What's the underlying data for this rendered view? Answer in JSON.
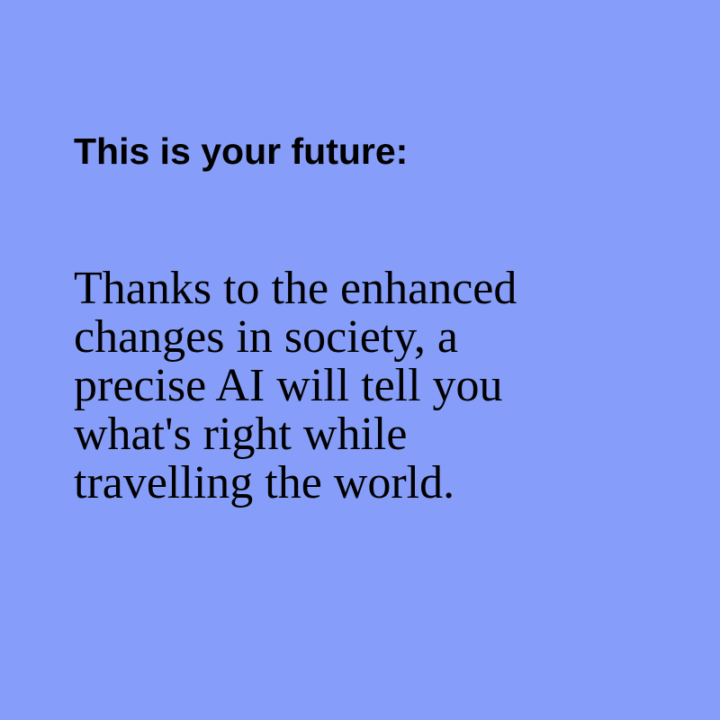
{
  "colors": {
    "background": "#869ef9",
    "text": "#000000"
  },
  "heading": "This is your future:",
  "body_lines": [
    "Thanks to the enhanced",
    "changes in society, a",
    "precise AI will tell you",
    "what's right while",
    "travelling the world."
  ]
}
